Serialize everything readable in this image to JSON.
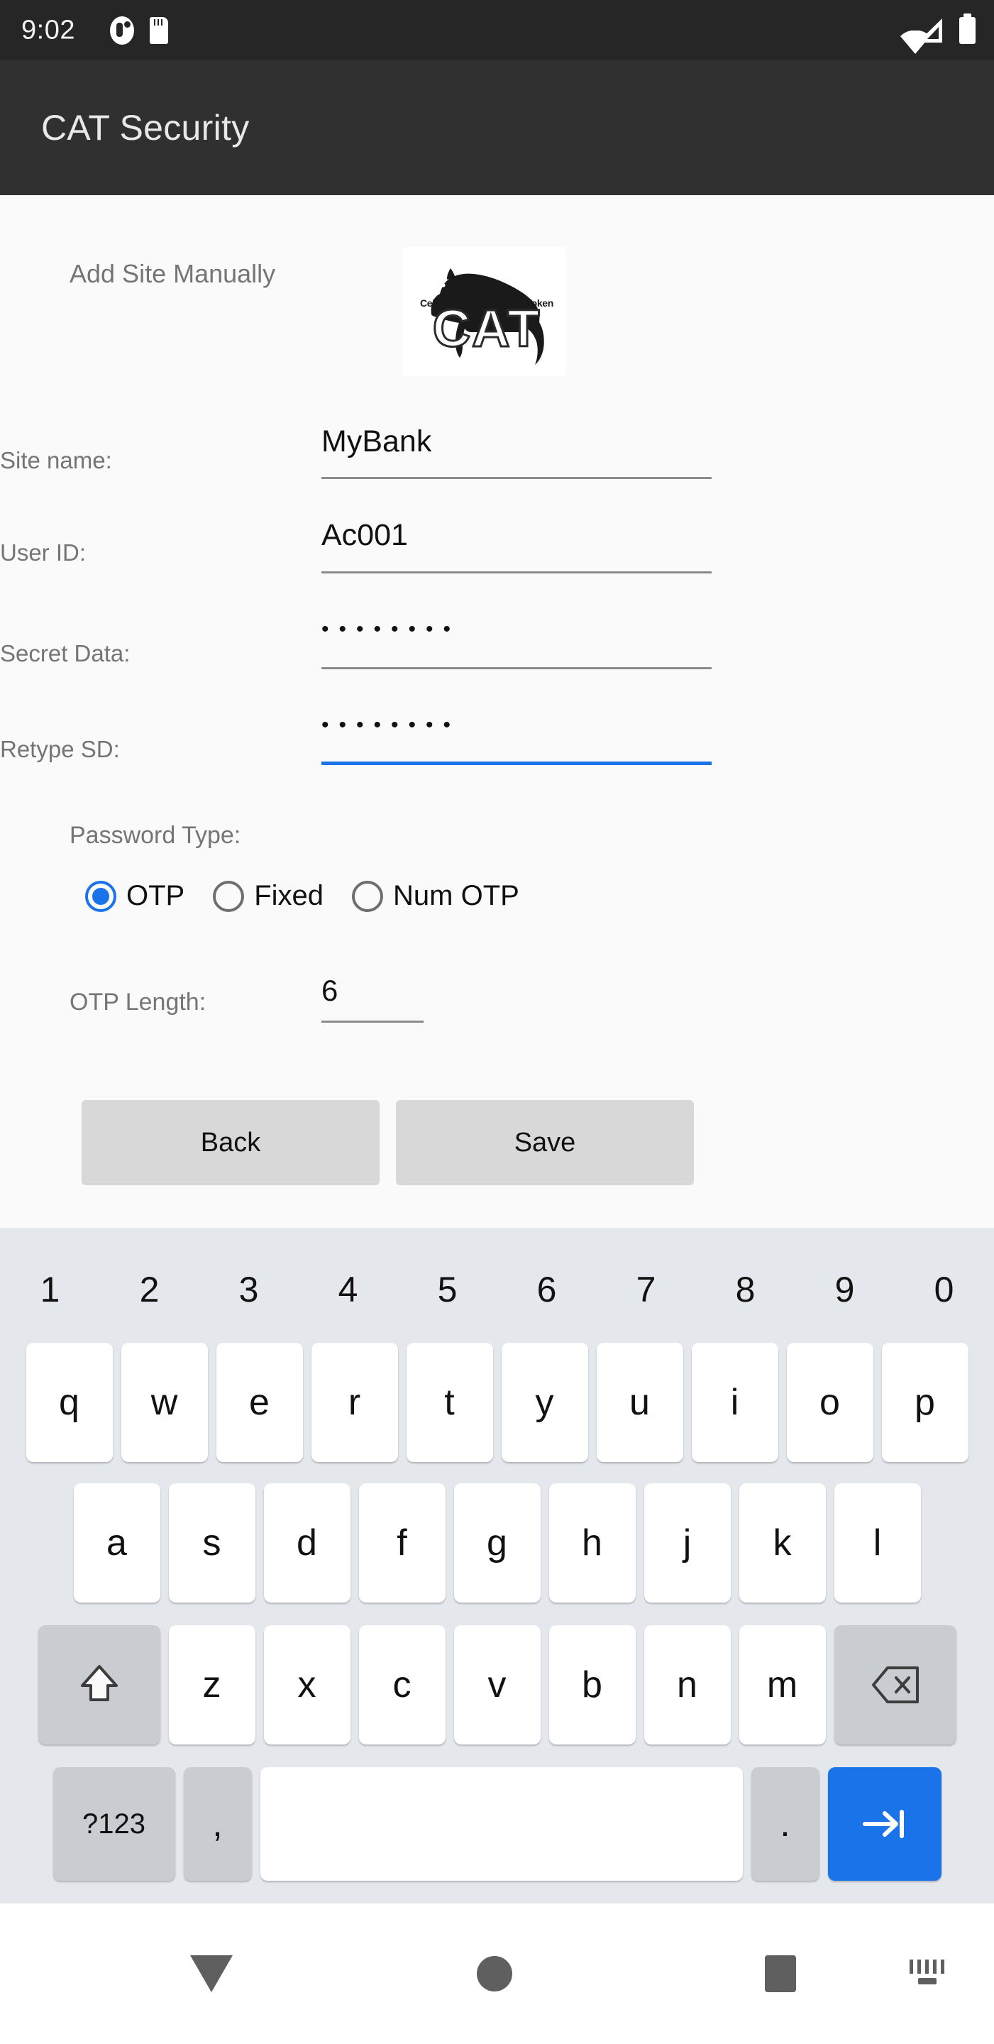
{
  "status_bar": {
    "time": "9:02",
    "left_icons": [
      "clock-icon",
      "sd-card-icon"
    ],
    "right_icons": [
      "wifi-icon",
      "cellular-signal-icon",
      "battery-icon"
    ]
  },
  "app_bar": {
    "title": "CAT Security"
  },
  "content": {
    "section_title": "Add Site Manually",
    "logo": {
      "name": "cat-logo",
      "tagline": "Cellular Authentication Token",
      "wordmark": "CAT"
    },
    "fields": [
      {
        "label": "Site name:",
        "value": "MyBank",
        "masked": false,
        "focused": false
      },
      {
        "label": "User ID:",
        "value": "Ac001",
        "masked": false,
        "focused": false
      },
      {
        "label": "Secret Data:",
        "value": "••••••••",
        "masked": true,
        "focused": false
      },
      {
        "label": "Retype SD:",
        "value": "••••••••",
        "masked": true,
        "focused": true
      }
    ],
    "password_type": {
      "label": "Password Type:",
      "options": [
        {
          "label": "OTP",
          "selected": true
        },
        {
          "label": "Fixed",
          "selected": false
        },
        {
          "label": "Num OTP",
          "selected": false
        }
      ]
    },
    "otp_length": {
      "label": "OTP Length:",
      "value": "6"
    },
    "buttons": {
      "back": "Back",
      "save": "Save"
    }
  },
  "keyboard": {
    "number_row": [
      "1",
      "2",
      "3",
      "4",
      "5",
      "6",
      "7",
      "8",
      "9",
      "0"
    ],
    "row1": [
      "q",
      "w",
      "e",
      "r",
      "t",
      "y",
      "u",
      "i",
      "o",
      "p"
    ],
    "row2": [
      "a",
      "s",
      "d",
      "f",
      "g",
      "h",
      "j",
      "k",
      "l"
    ],
    "row3": [
      "z",
      "x",
      "c",
      "v",
      "b",
      "n",
      "m"
    ],
    "shift_key": "shift-icon",
    "delete_key": "backspace-icon",
    "symbols_key": "?123",
    "comma_key": ",",
    "space_key": "",
    "period_key": ".",
    "enter_key": "next-arrow-icon"
  },
  "nav_bar": {
    "items": [
      "collapse-keyboard-icon",
      "home-icon",
      "recents-icon",
      "switch-keyboard-icon"
    ]
  },
  "colors": {
    "accent": "#1a73e8",
    "app_bar": "#303030",
    "status_bar": "#262626",
    "content_bg": "#fafafa",
    "keyboard_bg": "#e4e7ec",
    "label": "#757575",
    "button_bg": "#d8d8d8"
  }
}
